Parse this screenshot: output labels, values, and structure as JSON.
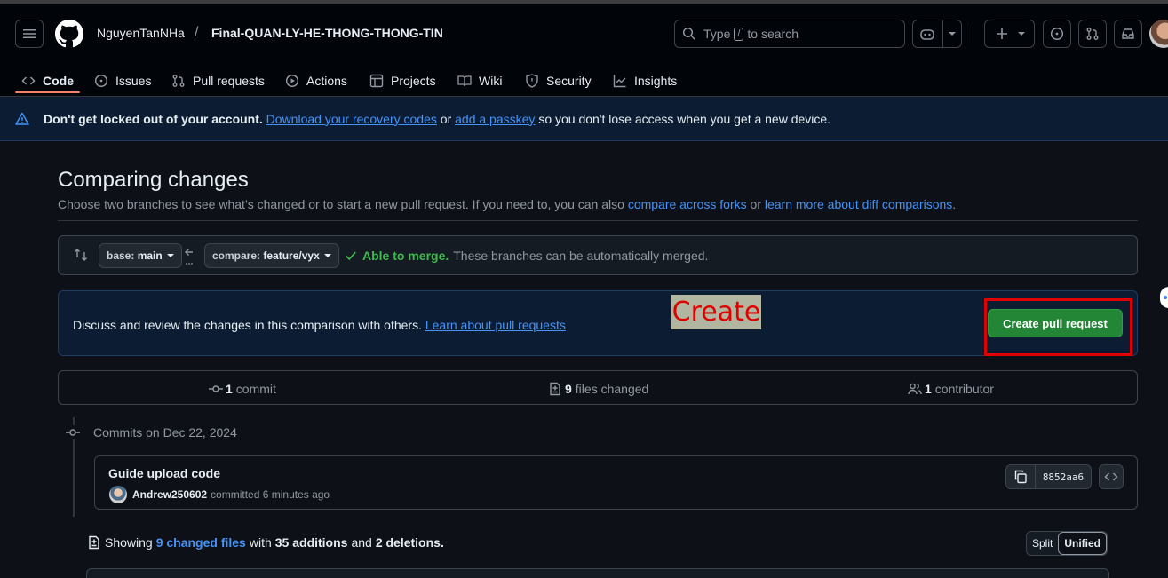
{
  "header": {
    "owner": "NguyenTanNHa",
    "slash": "/",
    "repo": "Final-QUAN-LY-HE-THONG-THONG-TIN",
    "search_prefix": "Type",
    "search_key": "/",
    "search_suffix": "to search"
  },
  "nav": {
    "tabs": [
      {
        "label": "Code",
        "icon": "code-icon",
        "active": true
      },
      {
        "label": "Issues",
        "icon": "issue-icon"
      },
      {
        "label": "Pull requests",
        "icon": "pull-request-icon"
      },
      {
        "label": "Actions",
        "icon": "play-icon"
      },
      {
        "label": "Projects",
        "icon": "table-icon"
      },
      {
        "label": "Wiki",
        "icon": "book-icon"
      },
      {
        "label": "Security",
        "icon": "shield-icon"
      },
      {
        "label": "Insights",
        "icon": "graph-icon"
      }
    ]
  },
  "banner": {
    "bold": "Don't get locked out of your account.",
    "link1": "Download your recovery codes",
    "or": "or",
    "link2": "add a passkey",
    "tail": "so you don't lose access when you get a new device."
  },
  "compare": {
    "title": "Comparing changes",
    "subtitle_text": "Choose two branches to see what’s changed or to start a new pull request. If you need to, you can also",
    "link_forks": "compare across forks",
    "or": "or",
    "link_learn": "learn more about diff comparisons",
    "period": ".",
    "base_label": "base:",
    "base_branch": "main",
    "compare_label": "compare:",
    "compare_branch": "feature/vyx",
    "merge_ok": "Able to merge.",
    "merge_text": "These branches can be automatically merged."
  },
  "discuss": {
    "text": "Discuss and review the changes in this comparison with others.",
    "link": "Learn about pull requests",
    "overlay_label": "Create",
    "create_button": "Create pull request"
  },
  "stats": {
    "commits_count": "1",
    "commits_label": "commit",
    "files_count": "9",
    "files_label": "files changed",
    "contrib_count": "1",
    "contrib_label": "contributor"
  },
  "commits": {
    "heading": "Commits on Dec 22, 2024",
    "title": "Guide upload code",
    "author": "Andrew250602",
    "meta": "committed 6 minutes ago",
    "sha": "8852aa6"
  },
  "summary": {
    "showing": "Showing",
    "files_link": "9 changed files",
    "with": "with",
    "additions": "35 additions",
    "and": "and",
    "deletions": "2 deletions.",
    "split": "Split",
    "unified": "Unified"
  },
  "colors": {
    "accent": "#4493f8",
    "success": "#238636",
    "highlight_red": "#e00000"
  }
}
